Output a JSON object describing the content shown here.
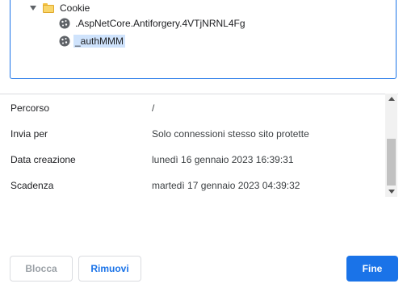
{
  "tree": {
    "folder": {
      "label": "Cookie",
      "icon": "folder-icon",
      "expanded": true
    },
    "items": [
      {
        "label": ".AspNetCore.Antiforgery.4VTjNRNL4Fg",
        "icon": "cookie-icon",
        "selected": false
      },
      {
        "label": "_authMMM",
        "icon": "cookie-icon",
        "selected": true
      }
    ]
  },
  "details": {
    "path_label": "Percorso",
    "path_value": "/",
    "send_for_label": "Invia per",
    "send_for_value": "Solo connessioni stesso sito protette",
    "created_label": "Data creazione",
    "created_value": "lunedì 16 gennaio 2023 16:39:31",
    "expires_label": "Scadenza",
    "expires_value": "martedì 17 gennaio 2023 04:39:32"
  },
  "buttons": {
    "block": "Blocca",
    "remove": "Rimuovi",
    "done": "Fine"
  },
  "colors": {
    "accent": "#1a73e8",
    "selection": "#cfe3fc"
  }
}
